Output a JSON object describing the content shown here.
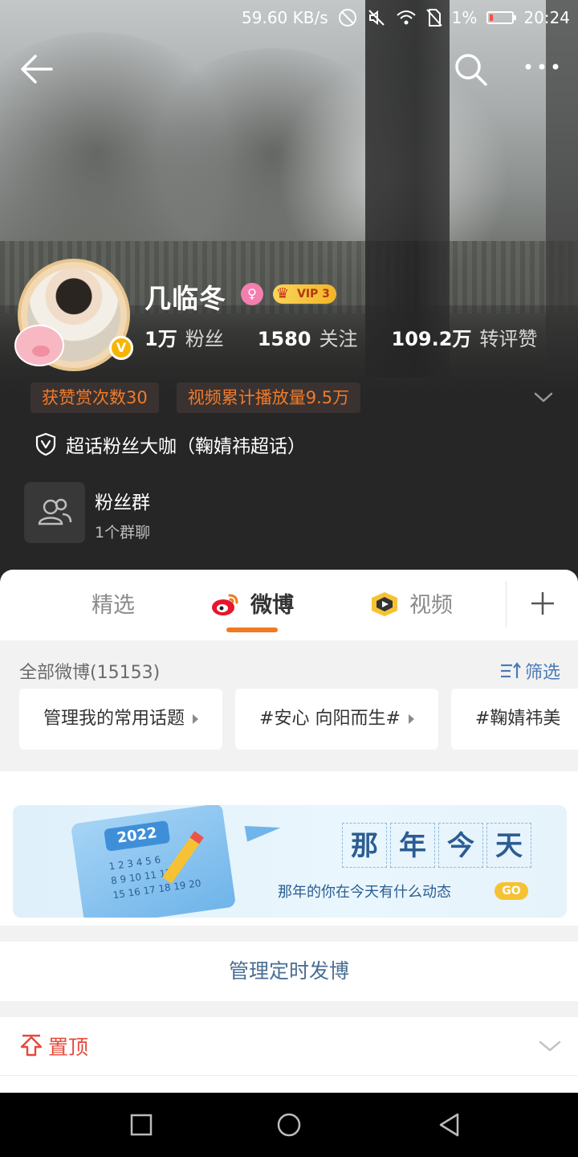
{
  "status_bar": {
    "speed": "59.60 KB/s",
    "battery": "1%",
    "time": "20:24"
  },
  "profile": {
    "name": "几临冬",
    "gender_icon": "female-icon",
    "vip_label": "VIP 3",
    "stats": [
      {
        "value": "1万",
        "label": "粉丝"
      },
      {
        "value": "1580",
        "label": "关注"
      },
      {
        "value": "109.2万",
        "label": "转评赞"
      }
    ],
    "tags": [
      "获赞赏次数30",
      "视频累计播放量9.5万"
    ],
    "super_topic": "超话粉丝大咖（鞠婧祎超话）",
    "fan_group": {
      "title": "粉丝群",
      "subtitle": "1个群聊"
    }
  },
  "tabs": [
    {
      "label": "精选",
      "active": false
    },
    {
      "label": "微博",
      "active": true
    },
    {
      "label": "视频",
      "active": false
    }
  ],
  "feed_filter": {
    "all_label": "全部微博(15153)",
    "filter_label": "筛选",
    "chips": [
      "管理我的常用话题",
      "#安心 向阳而生#",
      "#鞠婧祎美"
    ]
  },
  "banner": {
    "calendar_year": "2022",
    "calendar_numbers": "1 2 3 4 5 6\n8 9 10 11 12\n15 16 17 18 19 20",
    "title_chars": [
      "那",
      "年",
      "今",
      "天"
    ],
    "subtitle": "那年的你在今天有什么动态",
    "go_label": "GO"
  },
  "manage_scheduled": "管理定时发博",
  "pinned_label": "置顶",
  "colors": {
    "accent_orange": "#f07b22",
    "tag_text": "#f07b2b",
    "link_blue": "#4a7ab6",
    "pinned_red": "#e8473a"
  }
}
